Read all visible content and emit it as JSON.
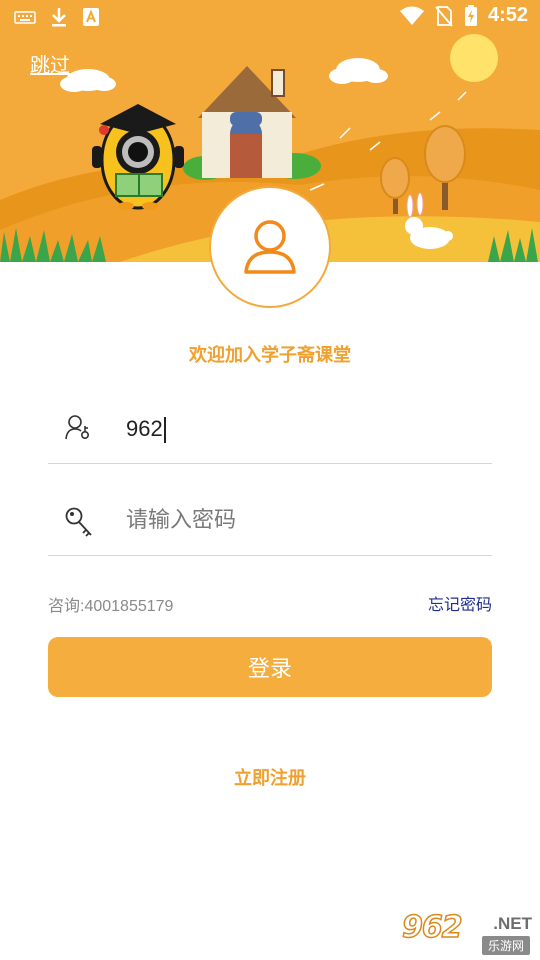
{
  "status_bar": {
    "time": "4:52"
  },
  "header": {
    "skip_label": "跳过"
  },
  "welcome_text": "欢迎加入学子斋课堂",
  "username_field": {
    "value": "962"
  },
  "password_field": {
    "placeholder": "请输入密码",
    "value": ""
  },
  "consult_text": "咨询:4001855179",
  "forgot_label": "忘记密码",
  "login_label": "登录",
  "register_label": "立即注册",
  "watermark": {
    "logo": "962",
    "net": ".NET",
    "subtitle": "乐游网"
  },
  "colors": {
    "accent": "#f4a93b",
    "link": "#1f2f8f",
    "placeholder": "#7a7a7a"
  }
}
